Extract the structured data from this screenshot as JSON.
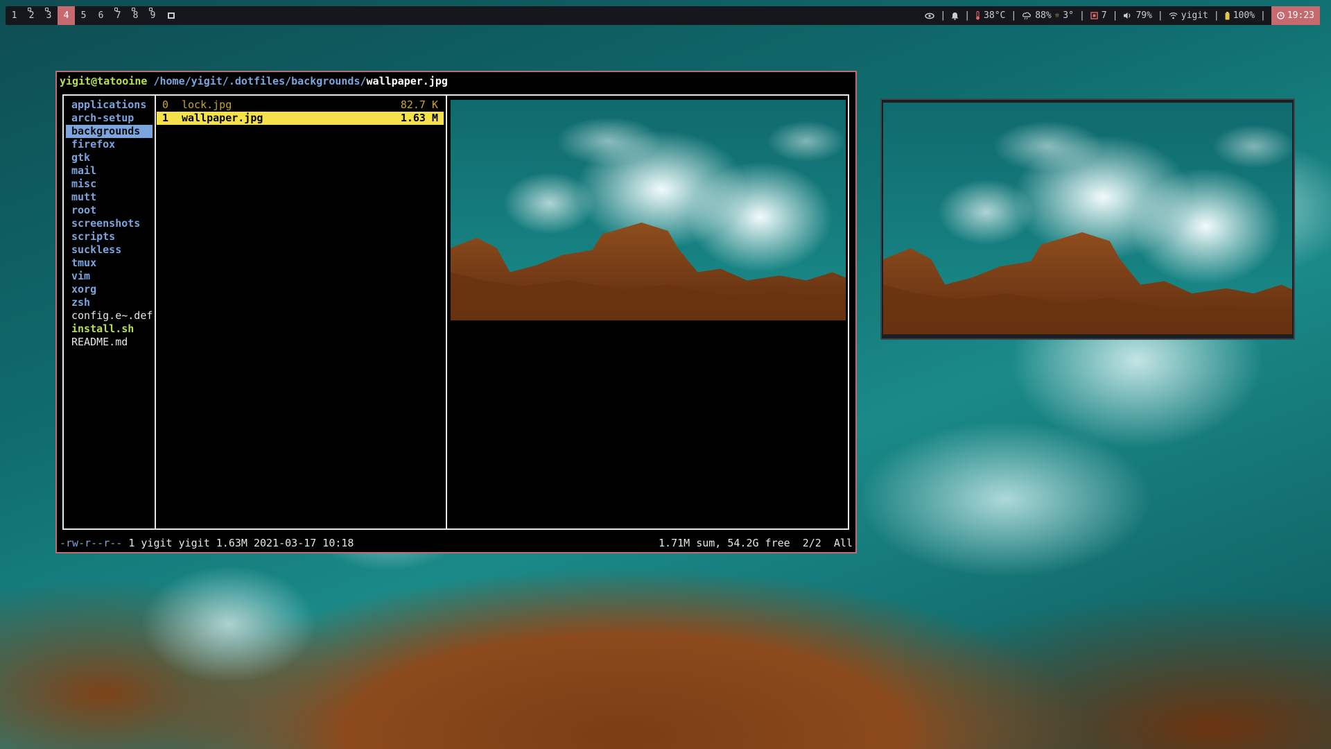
{
  "bar": {
    "tags": [
      "1",
      "2",
      "3",
      "4",
      "5",
      "6",
      "7",
      "8",
      "9"
    ],
    "active_tag": "4",
    "occupied_tags": [
      "2",
      "3",
      "7",
      "8",
      "9"
    ],
    "layout_icon": "floating-layout-icon",
    "status": {
      "eye_icon": "eye-icon",
      "bell_icon": "bell-icon",
      "temperature": "38°C",
      "weather_humidity": "88%",
      "weather_temp": "3°",
      "updates": "7",
      "volume": "79%",
      "wifi_name": "yigit",
      "battery": "100%",
      "time": "19:23"
    }
  },
  "terminal": {
    "title_host": "yigit@tatooine",
    "title_path": "/home/yigit/.dotfiles/backgrounds/",
    "title_file": "wallpaper.jpg",
    "parent_dir": [
      {
        "name": "applications",
        "type": "dir"
      },
      {
        "name": "arch-setup",
        "type": "dir"
      },
      {
        "name": "backgrounds",
        "type": "dir",
        "selected": true
      },
      {
        "name": "firefox",
        "type": "dir"
      },
      {
        "name": "gtk",
        "type": "dir"
      },
      {
        "name": "mail",
        "type": "dir"
      },
      {
        "name": "misc",
        "type": "dir"
      },
      {
        "name": "mutt",
        "type": "dir"
      },
      {
        "name": "root",
        "type": "dir"
      },
      {
        "name": "screenshots",
        "type": "dir"
      },
      {
        "name": "scripts",
        "type": "dir"
      },
      {
        "name": "suckless",
        "type": "dir"
      },
      {
        "name": "tmux",
        "type": "dir"
      },
      {
        "name": "vim",
        "type": "dir"
      },
      {
        "name": "xorg",
        "type": "dir"
      },
      {
        "name": "zsh",
        "type": "dir"
      },
      {
        "name": "config.e~.def",
        "type": "file"
      },
      {
        "name": "install.sh",
        "type": "exec"
      },
      {
        "name": "README.md",
        "type": "file"
      }
    ],
    "files": [
      {
        "index": "0",
        "name": "lock.jpg",
        "size": "82.7 K",
        "selected": false
      },
      {
        "index": "1",
        "name": "wallpaper.jpg",
        "size": "1.63 M",
        "selected": true
      }
    ],
    "status_perm": "-rw-r--r--",
    "status_info": "1 yigit yigit 1.63M 2021-03-17 10:18",
    "status_right": "1.71M sum, 54.2G free  2/2  All"
  },
  "colors": {
    "accent": "#c66a6f",
    "dir_blue": "#7aa5de",
    "exec_green": "#b8e04a",
    "selection_yellow": "#f5e14a",
    "image_file": "#c8a62a"
  }
}
